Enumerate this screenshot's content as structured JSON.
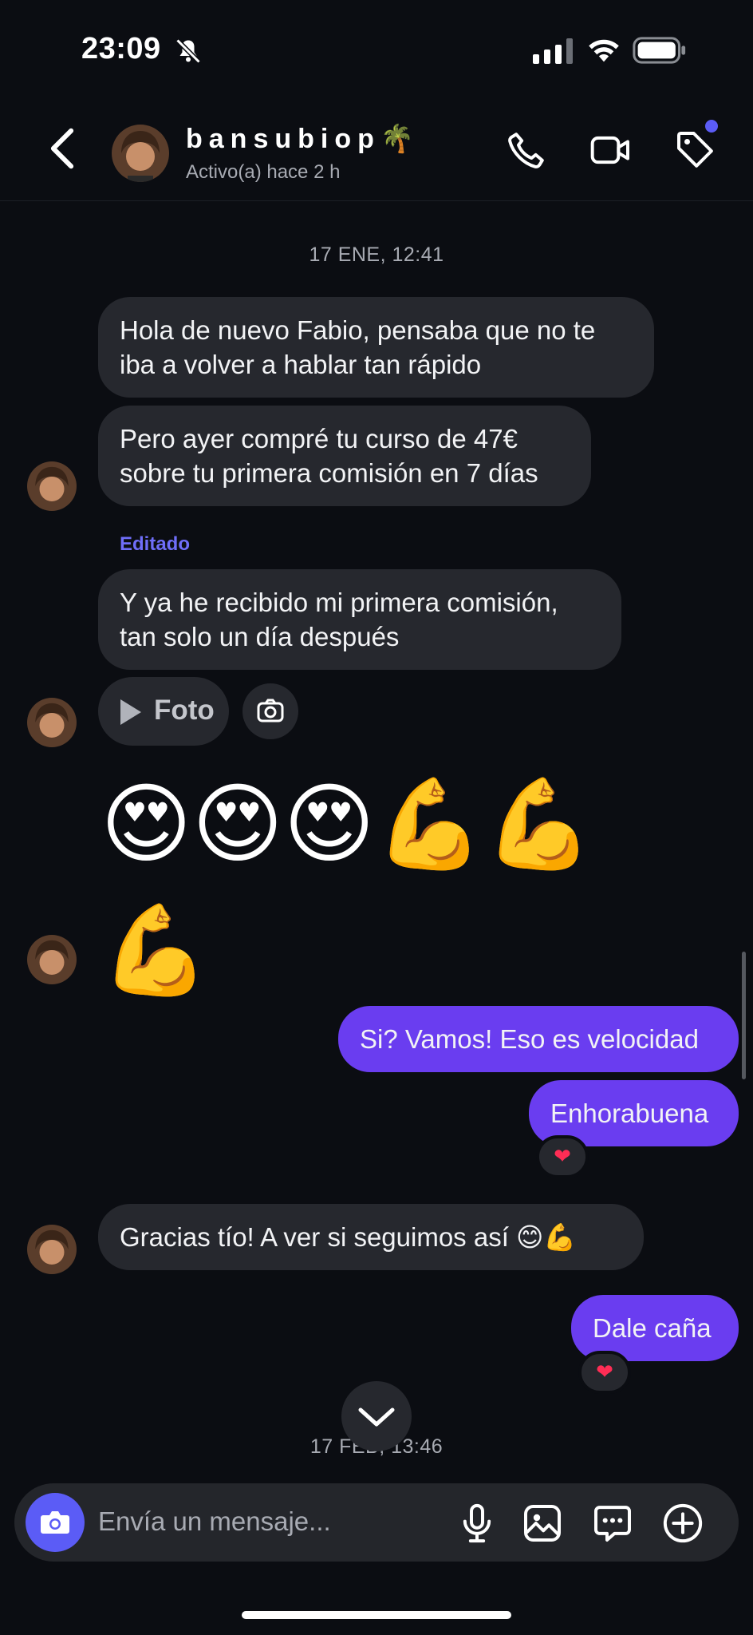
{
  "status_bar": {
    "time": "23:09"
  },
  "header": {
    "name": "bansubiop🌴",
    "status": "Activo(a) hace 2 h"
  },
  "chat": {
    "date_1": "17 ENE, 12:41",
    "msg_1": "Hola de nuevo Fabio, pensaba que no te iba a volver a hablar tan rápido",
    "msg_2": "Pero ayer compré tu curso de 47€ sobre tu primera comisión en 7 días",
    "edited_label": "Editado",
    "msg_3": "Y ya he recibido mi primera comisión, tan solo un día después",
    "foto_label": "Foto",
    "emoji_row_1": "😍😍😍💪💪",
    "emoji_row_2": "💪",
    "out_1": "Si? Vamos! Eso es velocidad",
    "out_2": "Enhorabuena",
    "reaction_1": "❤",
    "msg_4": "Gracias tío! A ver si seguimos así 😊💪",
    "out_3": "Dale caña",
    "reaction_2": "❤",
    "date_2": "17 FEB, 13:46"
  },
  "composer": {
    "placeholder": "Envía un mensaje..."
  },
  "colors": {
    "accent": "#5b5cf6",
    "outgoing_bubble": "#6a3df0",
    "incoming_bubble": "#26282e",
    "background": "#0b0d12"
  }
}
